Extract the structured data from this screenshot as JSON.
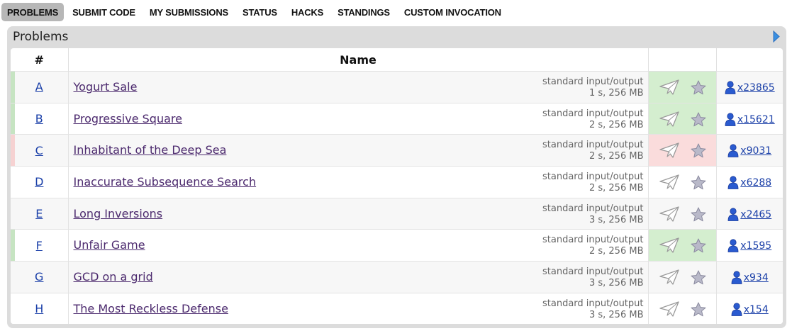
{
  "nav": {
    "items": [
      {
        "label": "PROBLEMS",
        "active": true
      },
      {
        "label": "SUBMIT CODE",
        "active": false
      },
      {
        "label": "MY SUBMISSIONS",
        "active": false
      },
      {
        "label": "STATUS",
        "active": false
      },
      {
        "label": "HACKS",
        "active": false
      },
      {
        "label": "STANDINGS",
        "active": false
      },
      {
        "label": "CUSTOM INVOCATION",
        "active": false
      }
    ]
  },
  "panel": {
    "title": "Problems",
    "arrow_icon": "right-triangle-icon"
  },
  "table": {
    "headers": {
      "index": "#",
      "name": "Name",
      "actions": "",
      "solved": ""
    },
    "colors": {
      "accepted_bar": "#c6e4c2",
      "accepted_cell": "#d4eecf",
      "rejected_bar": "#f6d2d2",
      "rejected_cell": "#fadcdc",
      "link_blue": "#1a3fa8",
      "visited_purple": "#4c2a6e"
    },
    "rows": [
      {
        "index": "A",
        "name": "Yogurt Sale",
        "io": "standard input/output",
        "limits": "1 s, 256 MB",
        "status": "accepted",
        "solved": "x23865"
      },
      {
        "index": "B",
        "name": "Progressive Square",
        "io": "standard input/output",
        "limits": "2 s, 256 MB",
        "status": "accepted",
        "solved": "x15621"
      },
      {
        "index": "C",
        "name": "Inhabitant of the Deep Sea",
        "io": "standard input/output",
        "limits": "2 s, 256 MB",
        "status": "rejected",
        "solved": "x9031"
      },
      {
        "index": "D",
        "name": "Inaccurate Subsequence Search",
        "io": "standard input/output",
        "limits": "2 s, 256 MB",
        "status": "none",
        "solved": "x6288"
      },
      {
        "index": "E",
        "name": "Long Inversions",
        "io": "standard input/output",
        "limits": "3 s, 256 MB",
        "status": "none",
        "solved": "x2465"
      },
      {
        "index": "F",
        "name": "Unfair Game",
        "io": "standard input/output",
        "limits": "2 s, 256 MB",
        "status": "accepted",
        "solved": "x1595"
      },
      {
        "index": "G",
        "name": "GCD on a grid",
        "io": "standard input/output",
        "limits": "3 s, 256 MB",
        "status": "none",
        "solved": "x934"
      },
      {
        "index": "H",
        "name": "The Most Reckless Defense",
        "io": "standard input/output",
        "limits": "3 s, 256 MB",
        "status": "none",
        "solved": "x154"
      }
    ],
    "icons": {
      "submit": "paper-plane-icon",
      "favorite": "star-icon",
      "solved_by": "user-icon"
    }
  }
}
